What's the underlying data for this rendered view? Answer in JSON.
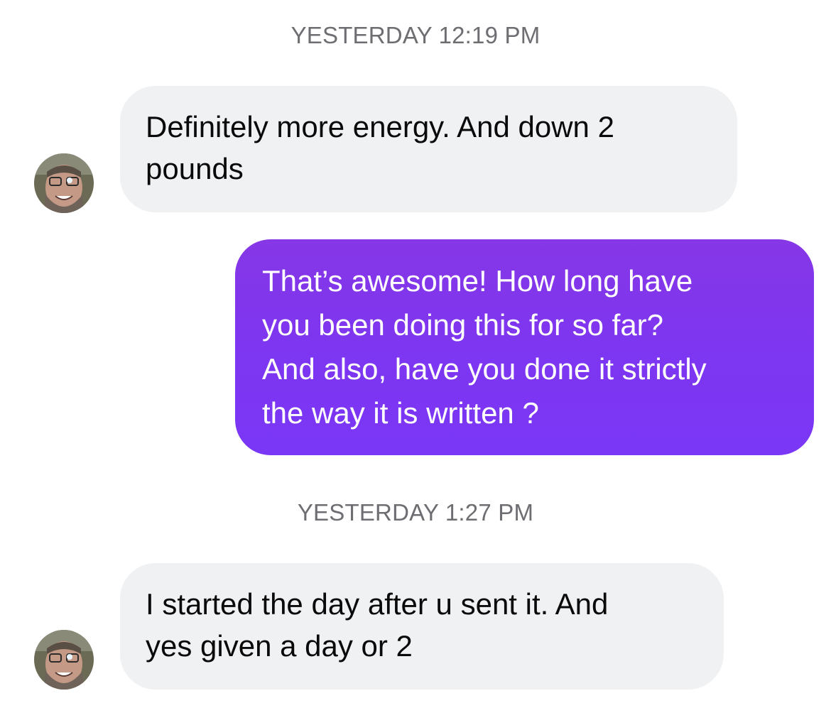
{
  "conversation": {
    "timestamps": [
      "YESTERDAY 12:19 PM",
      "YESTERDAY 1:27 PM"
    ],
    "messages": [
      {
        "direction": "incoming",
        "text": "Definitely more energy.  And down 2\npounds"
      },
      {
        "direction": "outgoing",
        "text": "That’s awesome! How long have\nyou been doing this for so far?\nAnd also, have you done it strictly\nthe way it is written ?"
      },
      {
        "direction": "incoming",
        "text": "I started the day after u sent it. And\nyes given a day or 2"
      }
    ],
    "avatar_icon": "contact-photo",
    "colors": {
      "incoming_bubble": "#f0f1f3",
      "outgoing_bubble": "#7d36f1",
      "timestamp_text": "#6d6d72"
    }
  }
}
